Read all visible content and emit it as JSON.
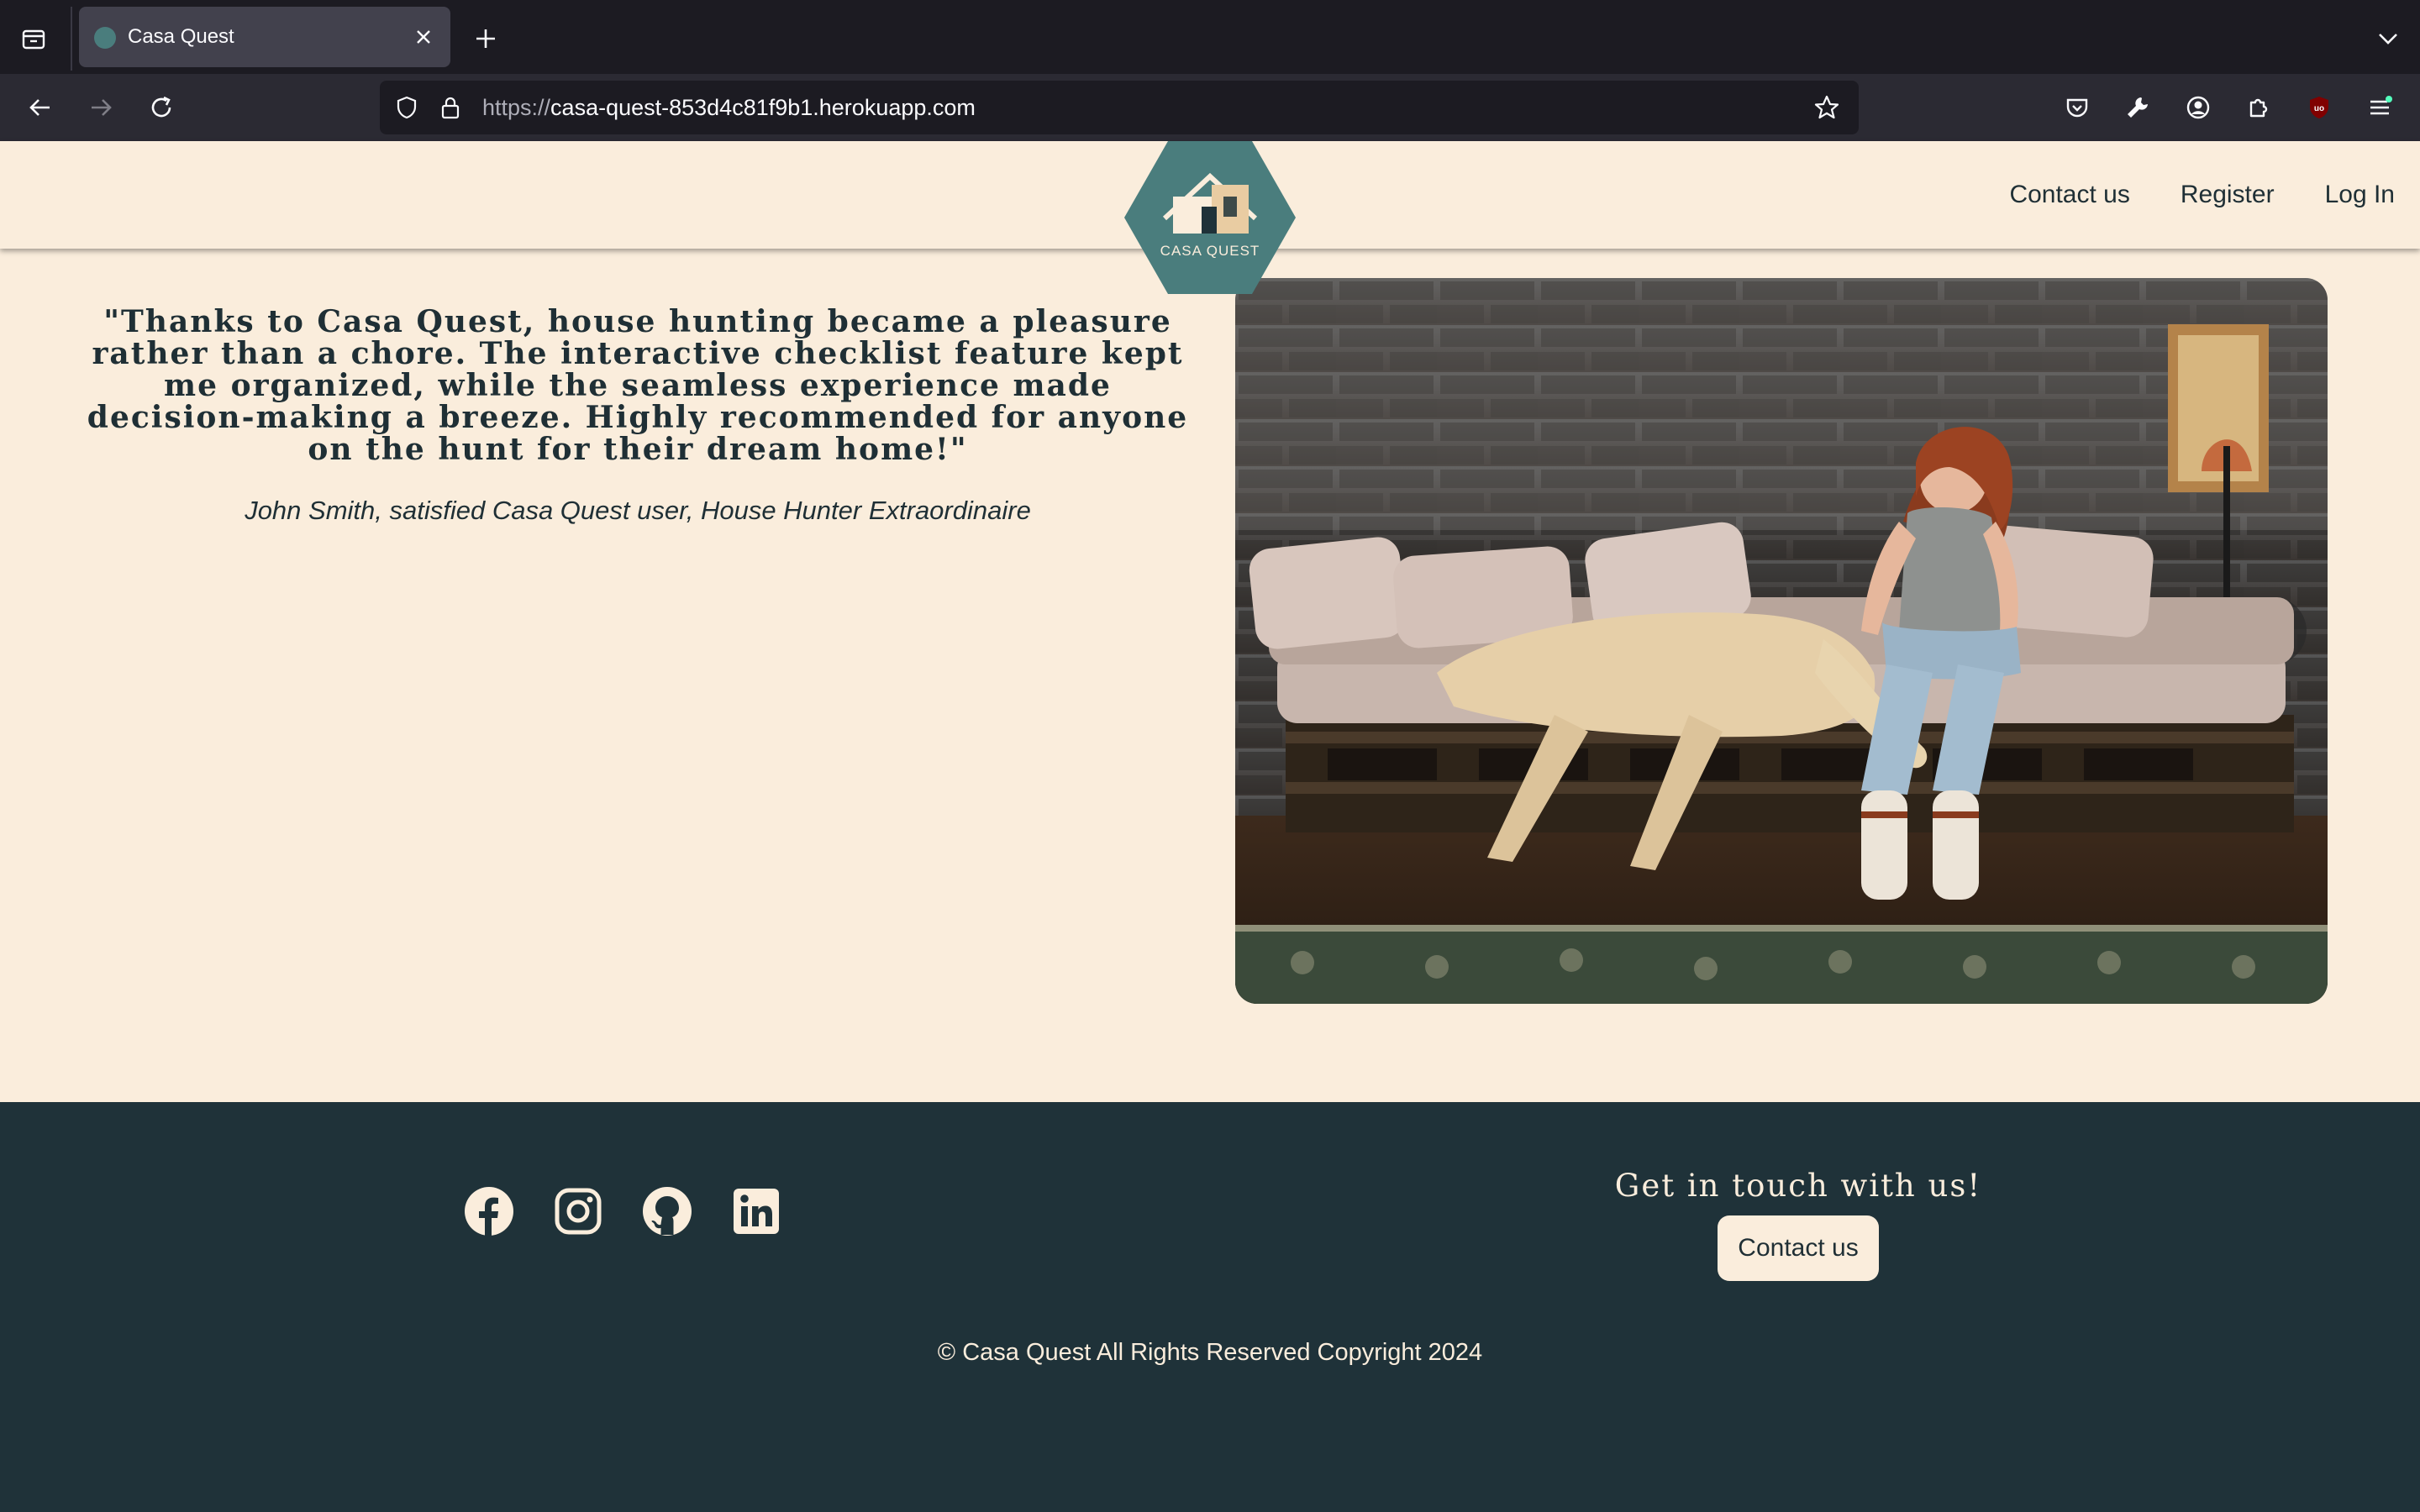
{
  "browser": {
    "tab_title": "Casa Quest",
    "url_scheme": "https://",
    "url_host": "casa-quest-853d4c81f9b1.herokuapp.com"
  },
  "site": {
    "logo_text": "CASA QUEST",
    "nav": [
      "Contact us",
      "Register",
      "Log In"
    ]
  },
  "testimonial": {
    "quote": "\"Thanks to Casa Quest, house hunting became a pleasure rather than a chore. The interactive checklist feature kept me organized, while the seamless experience made decision-making a breeze. Highly recommended for anyone on the hunt for their dream home!\"",
    "author": "John Smith, satisfied Casa Quest user, House Hunter Extraordinaire"
  },
  "footer": {
    "socials": [
      "facebook-icon",
      "instagram-icon",
      "github-icon",
      "linkedin-icon"
    ],
    "contact_heading": "Get in touch with us!",
    "contact_button": "Contact us",
    "copyright": "© Casa Quest All Rights Reserved Copyright 2024"
  },
  "colors": {
    "page_bg": "#faeddc",
    "dark_teal": "#1f3239",
    "logo_teal": "#4a7d7d",
    "text_dark": "#1f2f35"
  }
}
